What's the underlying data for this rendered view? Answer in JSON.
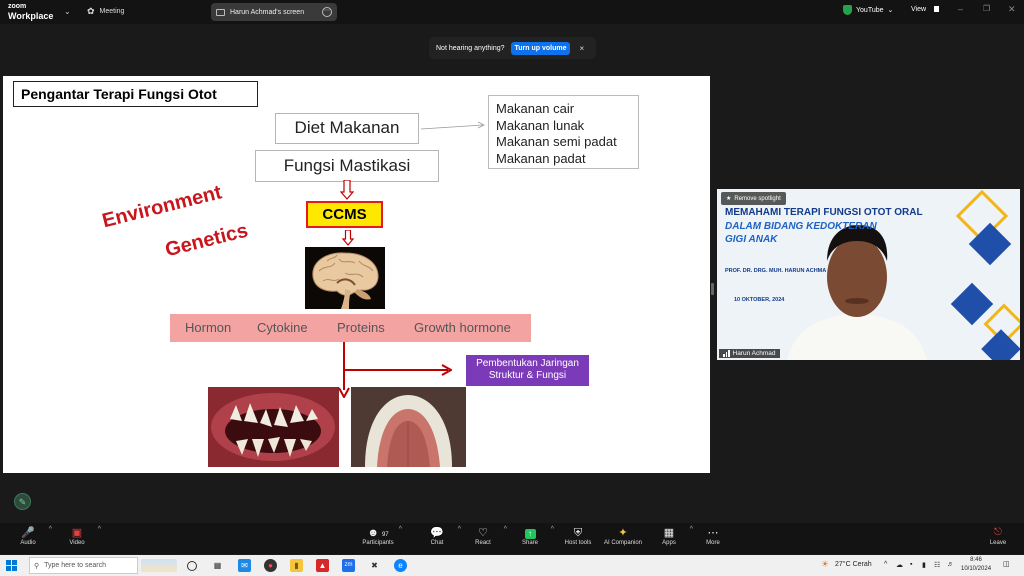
{
  "topbar": {
    "logo_line1": "zoom",
    "logo_line2": "Workplace",
    "meeting_label": "Meeting",
    "share_label": "Harun Achmad's screen",
    "youtube_label": "YouTube",
    "view_label": "View"
  },
  "notice": {
    "text": "Not hearing anything?",
    "button": "Turn up volume",
    "close": "×"
  },
  "slide": {
    "title": "Pengantar Terapi Fungsi Otot",
    "diet": "Diet Makanan",
    "mastication": "Fungsi Mastikasi",
    "foods": [
      "Makanan cair",
      "Makanan lunak",
      "Makanan semi padat",
      "Makanan padat"
    ],
    "environment": "Environment",
    "genetics": "Genetics",
    "ccms": "CCMS",
    "factors": [
      "Hormon",
      "Cytokine",
      "Proteins",
      "Growth hormone"
    ],
    "outcome_line1": "Pembentukan Jaringan",
    "outcome_line2": "Struktur & Fungsi"
  },
  "camera": {
    "spotlight": "Remove spotlight",
    "title1": "MEMAHAMI TERAPI FUNGSI OTOT ORAL",
    "title2": "DALAM BIDANG KEDOKTERAN",
    "title3": "GIGI ANAK",
    "presenter": "PROF. DR. DRG. MUH. HARUN ACHMA",
    "date": "10 OKTOBER, 2024",
    "name": "Harun Achmad"
  },
  "toolbar": {
    "audio": "Audio",
    "video": "Video",
    "participants": "Participants",
    "participant_count": "97",
    "chat": "Chat",
    "react": "React",
    "share": "Share",
    "host_tools": "Host tools",
    "ai_companion": "AI Companion",
    "apps": "Apps",
    "more": "More",
    "leave": "Leave"
  },
  "taskbar": {
    "search_placeholder": "Type here to search",
    "weather": "27°C  Cerah",
    "time": "8:46",
    "date": "10/10/2024"
  },
  "colors": {
    "accent_blue": "#0e72ed",
    "slide_red": "#c8161d",
    "ccms_yellow": "#ffe800",
    "band_pink": "#f4a3a3",
    "outcome_purple": "#7b3ab8"
  }
}
